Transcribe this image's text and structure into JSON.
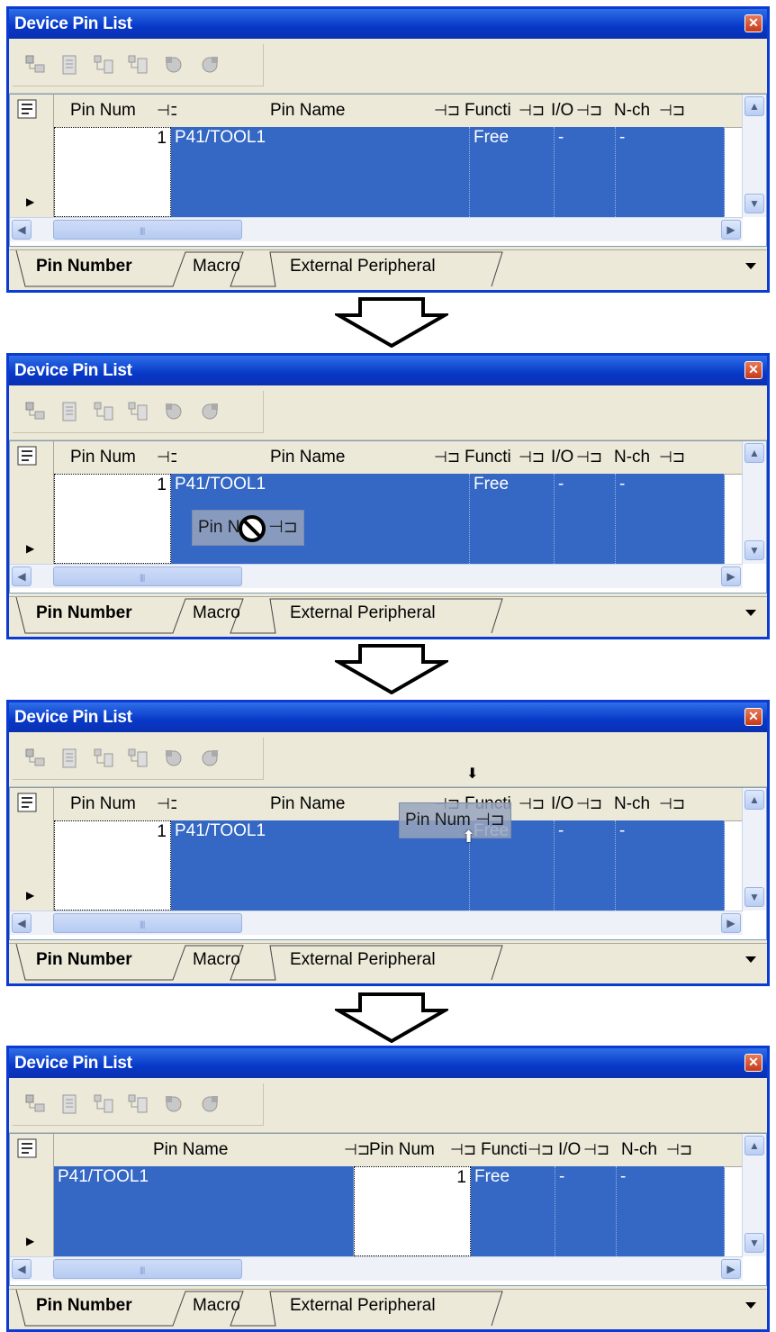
{
  "window": {
    "title": "Device Pin List",
    "close_label": "✕"
  },
  "toolbar_icons": [
    "view-tree-icon",
    "list-icon",
    "expand-icon",
    "collapse-icon",
    "gear-disabled-icon",
    "gear2-disabled-icon"
  ],
  "columns": {
    "pin_num": "Pin Num",
    "pin_name": "Pin Name",
    "function": "Functi",
    "io": "I/O",
    "nch": "N-ch"
  },
  "row": {
    "pin_num": "1",
    "pin_name": "P41/TOOL1",
    "function": "Free",
    "io": "-",
    "nch": "-"
  },
  "tabs": [
    "Pin Number",
    "Macro",
    "External Peripheral"
  ],
  "drag_label": "Pin Num",
  "colors": {
    "title_blue": "#0b3bd1",
    "selection_blue": "#3468c4",
    "panel_bg": "#ece9d8"
  }
}
